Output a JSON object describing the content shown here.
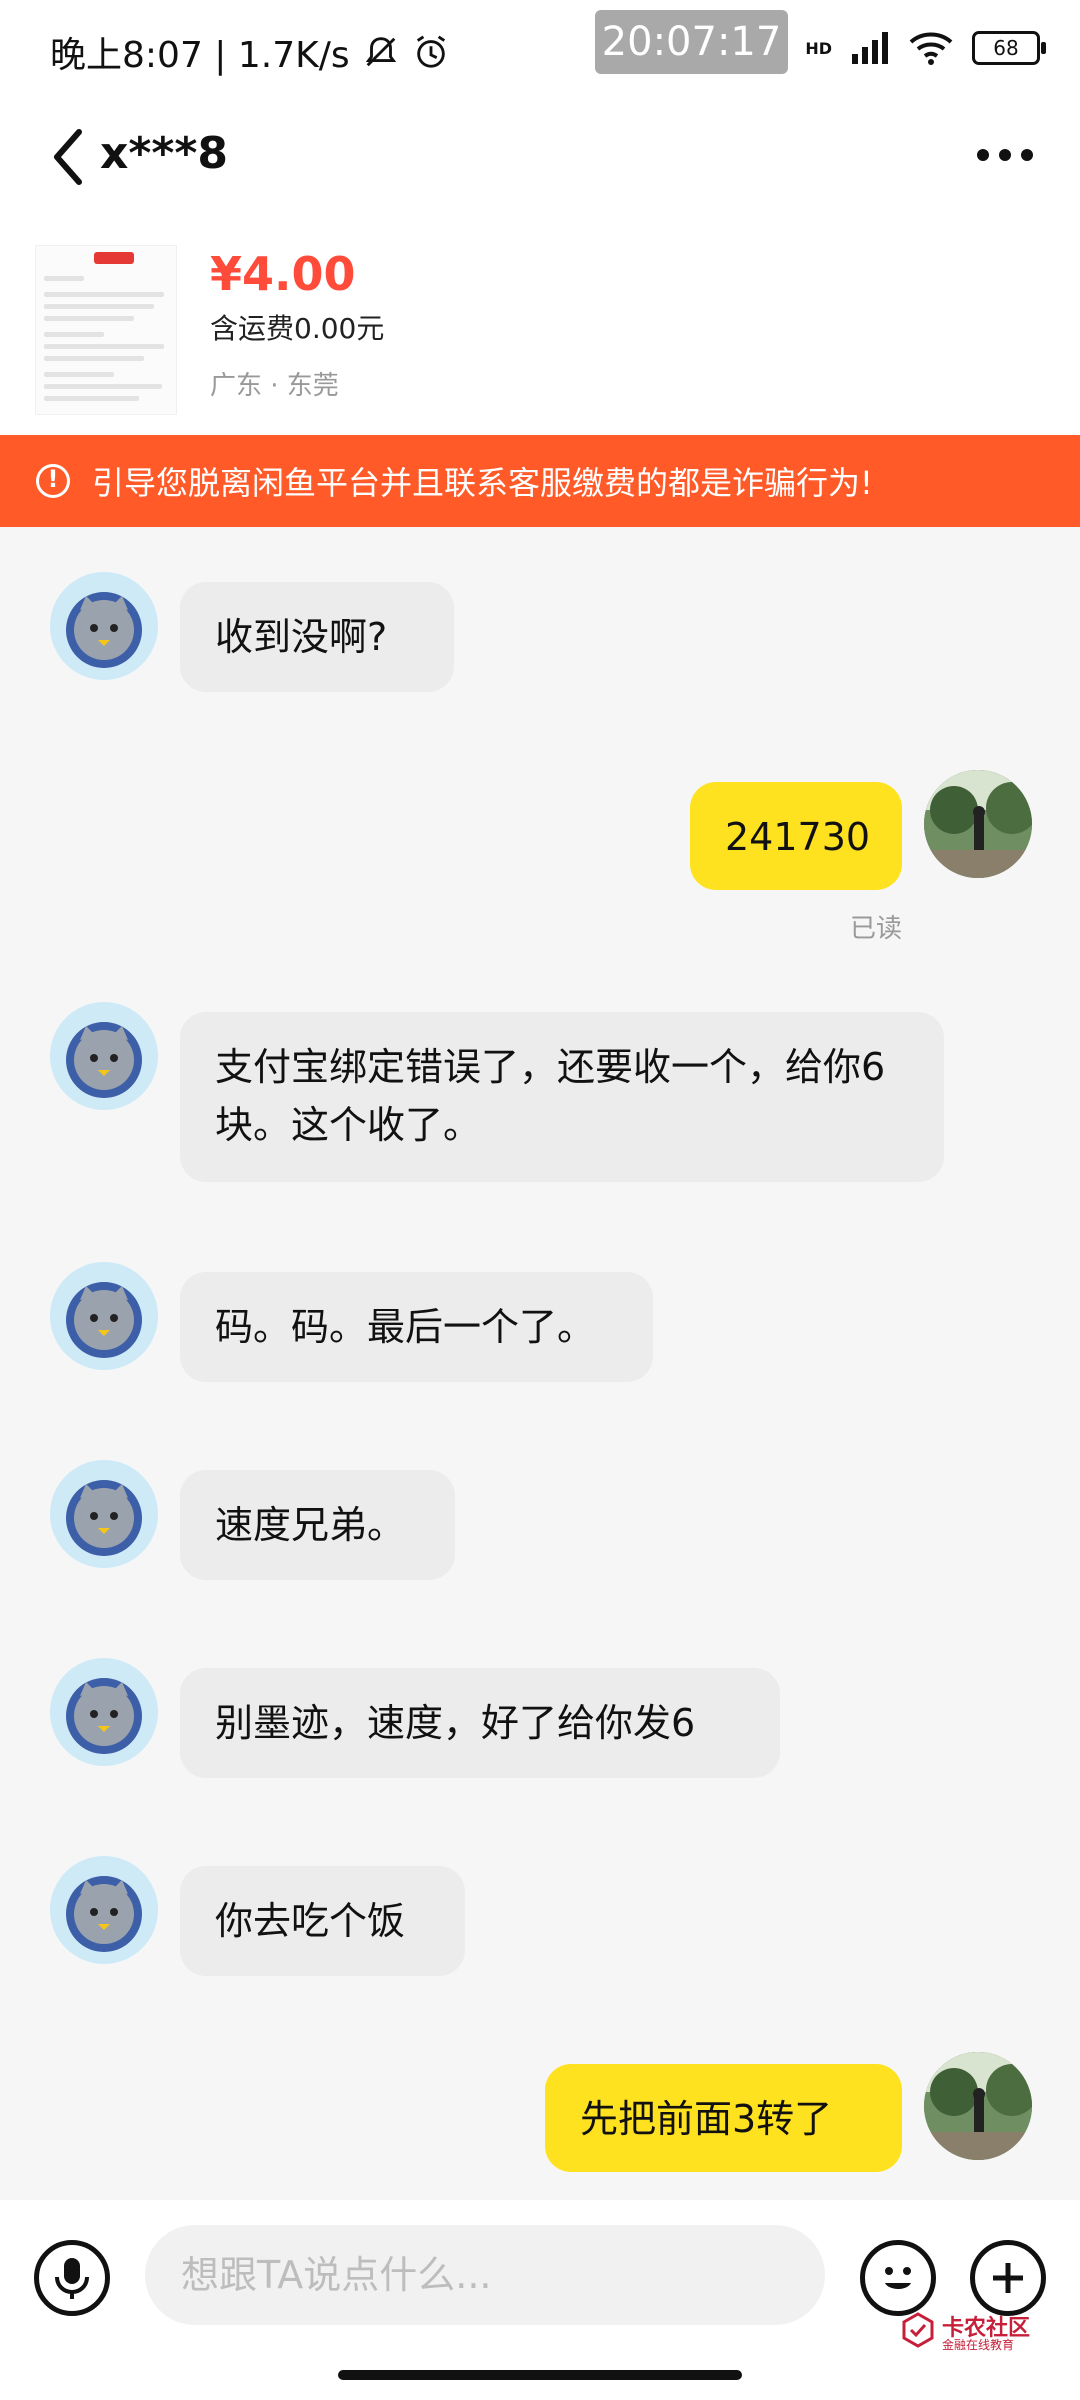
{
  "status_bar": {
    "left_text": "晚上8:07 | 1.7K/s",
    "time": "20:07:17",
    "network_label": "HD",
    "battery": "68"
  },
  "header": {
    "title": "x***8"
  },
  "product": {
    "price": "¥4.00",
    "shipping": "含运费0.00元",
    "location": "广东 · 东莞"
  },
  "warning": {
    "text": "引导您脱离闲鱼平台并且联系客服缴费的都是诈骗行为!"
  },
  "messages": [
    {
      "side": "in",
      "text": "收到没啊?"
    },
    {
      "side": "out",
      "text": "241730",
      "status": "已读"
    },
    {
      "side": "in",
      "text": "支付宝绑定错误了，还要收一个，给你6块。这个收了。"
    },
    {
      "side": "in",
      "text": "码。码。最后一个了。"
    },
    {
      "side": "in",
      "text": "速度兄弟。"
    },
    {
      "side": "in",
      "text": "别墨迹，速度，好了给你发6"
    },
    {
      "side": "in",
      "text": "你去吃个饭"
    },
    {
      "side": "out",
      "text": "先把前面3转了"
    }
  ],
  "input": {
    "placeholder": "想跟TA说点什么..."
  },
  "watermark": {
    "title": "卡农社区",
    "subtitle": "金融在线教育"
  },
  "colors": {
    "accent_price": "#ff4b3a",
    "warning_bg": "#ff5a28",
    "outgoing_bubble": "#ffe21f",
    "incoming_bubble": "#ececec"
  }
}
